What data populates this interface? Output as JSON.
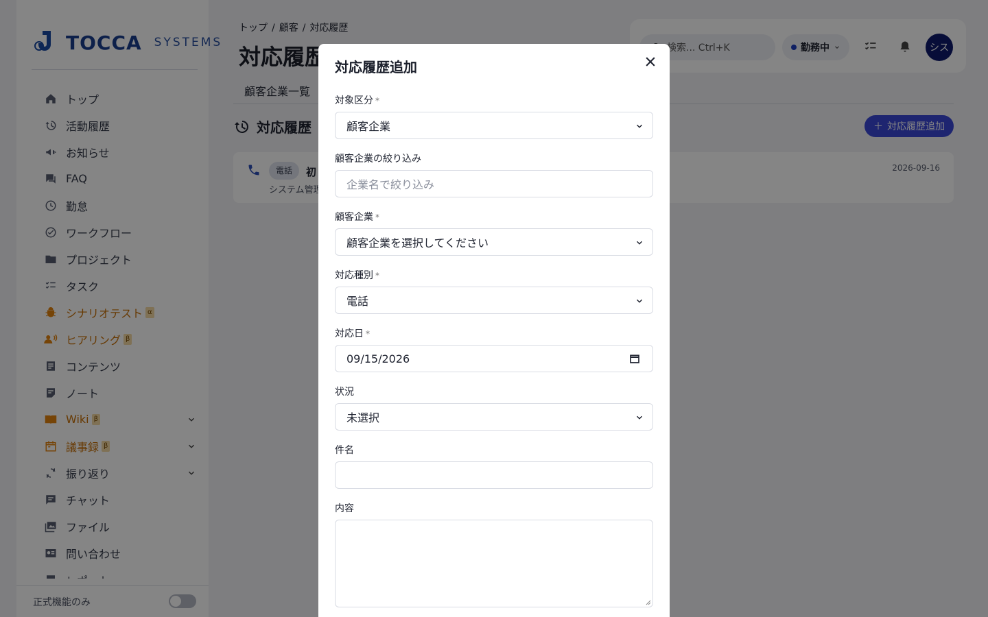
{
  "brand": {
    "name": "TOCCA",
    "sub": "SYSTEMS"
  },
  "sidebar": {
    "items": [
      {
        "label": "トップ",
        "icon": "home-icon"
      },
      {
        "label": "活動履歴",
        "icon": "history-icon"
      },
      {
        "label": "お知らせ",
        "icon": "megaphone-icon"
      },
      {
        "label": "FAQ",
        "icon": "forum-icon"
      },
      {
        "label": "勤怠",
        "icon": "clock-icon"
      },
      {
        "label": "ワークフロー",
        "icon": "check-circle-icon"
      },
      {
        "label": "プロジェクト",
        "icon": "folder-icon"
      },
      {
        "label": "タスク",
        "icon": "checklist-icon"
      },
      {
        "label": "シナリオテスト",
        "icon": "bug-icon",
        "badge": "α"
      },
      {
        "label": "ヒアリング",
        "icon": "interview-icon",
        "badge": "β"
      },
      {
        "label": "コンテンツ",
        "icon": "article-icon"
      },
      {
        "label": "ノート",
        "icon": "note-icon"
      },
      {
        "label": "Wiki",
        "icon": "book-icon",
        "badge": "β"
      },
      {
        "label": "議事録",
        "icon": "calendar-icon",
        "badge": "β"
      },
      {
        "label": "振り返り",
        "icon": "sync-icon"
      },
      {
        "label": "チャット",
        "icon": "chat-icon"
      },
      {
        "label": "ファイル",
        "icon": "image-icon"
      },
      {
        "label": "問い合わせ",
        "icon": "contact-card-icon"
      },
      {
        "label": "レポート",
        "icon": "report-icon"
      }
    ],
    "footer_label": "正式機能のみ"
  },
  "breadcrumb": [
    "トップ",
    "顧客",
    "対応履歴"
  ],
  "page_title": "対応履歴",
  "tabs": {
    "first": "顧客企業一覧"
  },
  "section": {
    "title": "対応履歴",
    "add_button": "対応履歴追加"
  },
  "card": {
    "tag": "電話",
    "title": "初",
    "sub": "システム管理者",
    "date": "2026-09-16"
  },
  "topbar": {
    "search_placeholder": "検索... Ctrl+K",
    "status": "勤務中",
    "avatar": "シス"
  },
  "modal": {
    "title": "対応履歴追加",
    "fields": {
      "target": {
        "label": "対象区分",
        "required": "*",
        "value": "顧客企業"
      },
      "filter": {
        "label": "顧客企業の絞り込み",
        "placeholder": "企業名で絞り込み"
      },
      "company": {
        "label": "顧客企業",
        "required": "*",
        "value": "顧客企業を選択してください"
      },
      "type": {
        "label": "対応種別",
        "required": "*",
        "value": "電話"
      },
      "date": {
        "label": "対応日",
        "required": "*",
        "value": "09/15/2026"
      },
      "status": {
        "label": "状況",
        "value": "未選択"
      },
      "subject": {
        "label": "件名",
        "value": ""
      },
      "content": {
        "label": "内容",
        "value": ""
      }
    }
  },
  "colors": {
    "primary": "#3b47d6",
    "accent_orange": "#e2820e",
    "avatar_bg": "#0e1a6b"
  }
}
